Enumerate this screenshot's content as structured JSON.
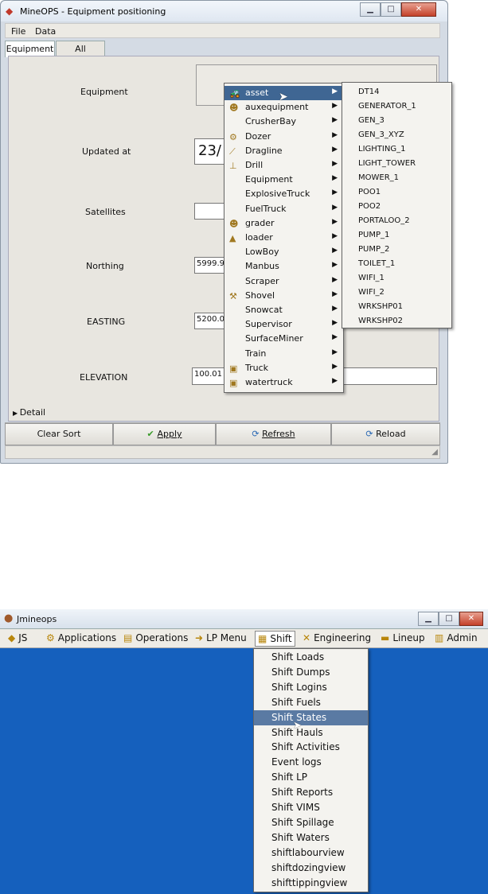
{
  "window1": {
    "title": "MineOPS - Equipment positioning",
    "menu": [
      "File",
      "Data"
    ],
    "tabs": [
      "Equipment",
      "All"
    ],
    "labels": {
      "equipment": "Equipment",
      "updated_at": "Updated at",
      "satellites": "Satellites",
      "northing": "Northing",
      "easting": "EASTING",
      "elevation": "ELEVATION",
      "detail": "Detail"
    },
    "values": {
      "updated_at": "23/",
      "northing": "5999.9",
      "easting": "5200.0",
      "elevation": "100.01"
    },
    "buttons": {
      "clear_sort": "Clear Sort",
      "apply": "Apply",
      "refresh": "Refresh",
      "reload": "Reload"
    },
    "context_menu": [
      {
        "label": "asset",
        "icon": "vehicle-icon",
        "highlighted": true
      },
      {
        "label": "auxequipment",
        "icon": "person-icon"
      },
      {
        "label": "CrusherBay",
        "icon": ""
      },
      {
        "label": "Dozer",
        "icon": "dozer-icon"
      },
      {
        "label": "Dragline",
        "icon": "dragline-icon"
      },
      {
        "label": "Drill",
        "icon": "drill-icon"
      },
      {
        "label": "Equipment",
        "icon": ""
      },
      {
        "label": "ExplosiveTruck",
        "icon": ""
      },
      {
        "label": "FuelTruck",
        "icon": ""
      },
      {
        "label": "grader",
        "icon": "person-icon"
      },
      {
        "label": "loader",
        "icon": "loader-icon"
      },
      {
        "label": "LowBoy",
        "icon": ""
      },
      {
        "label": "Manbus",
        "icon": ""
      },
      {
        "label": "Scraper",
        "icon": ""
      },
      {
        "label": "Shovel",
        "icon": "shovel-icon"
      },
      {
        "label": "Snowcat",
        "icon": ""
      },
      {
        "label": "Supervisor",
        "icon": ""
      },
      {
        "label": "SurfaceMiner",
        "icon": ""
      },
      {
        "label": "Train",
        "icon": ""
      },
      {
        "label": "Truck",
        "icon": "truck-icon"
      },
      {
        "label": "watertruck",
        "icon": "truck-icon"
      }
    ],
    "submenu": [
      "DT14",
      "GENERATOR_1",
      "GEN_3",
      "GEN_3_XYZ",
      "LIGHTING_1",
      "LIGHT_TOWER",
      "MOWER_1",
      "POO1",
      "POO2",
      "PORTALOO_2",
      "PUMP_1",
      "PUMP_2",
      "TOILET_1",
      "WIFI_1",
      "WIFI_2",
      "WRKSHP01",
      "WRKSHP02"
    ]
  },
  "window2": {
    "title": "Jmineops",
    "menubar": [
      {
        "label": "JS",
        "icon": "js-icon"
      },
      {
        "label": "Applications",
        "icon": "applications-icon"
      },
      {
        "label": "Operations",
        "icon": "operations-icon"
      },
      {
        "label": "LP Menu",
        "icon": "lp-icon"
      },
      {
        "label": "Shift",
        "icon": "shift-icon",
        "active": true
      },
      {
        "label": "Engineering",
        "icon": "engineering-icon"
      },
      {
        "label": "Lineup",
        "icon": "lineup-icon"
      },
      {
        "label": "Admin",
        "icon": "admin-icon"
      }
    ],
    "shift_menu": [
      {
        "label": "Shift Loads"
      },
      {
        "label": "Shift Dumps"
      },
      {
        "label": "Shift Logins"
      },
      {
        "label": "Shift Fuels"
      },
      {
        "label": "Shift States",
        "highlighted": true
      },
      {
        "label": "Shift Hauls"
      },
      {
        "label": "Shift Activities"
      },
      {
        "label": "Event logs"
      },
      {
        "label": "Shift LP"
      },
      {
        "label": "Shift Reports"
      },
      {
        "label": "Shift VIMS"
      },
      {
        "label": "Shift Spillage"
      },
      {
        "label": "Shift Waters"
      },
      {
        "label": "shiftlabourview"
      },
      {
        "label": "shiftdozingview"
      },
      {
        "label": "shifttippingview"
      }
    ]
  },
  "colors": {
    "desktop_blue": "#1560bd",
    "menu_highlight": "#3f6693",
    "shift_highlight": "#5a7aa3"
  }
}
